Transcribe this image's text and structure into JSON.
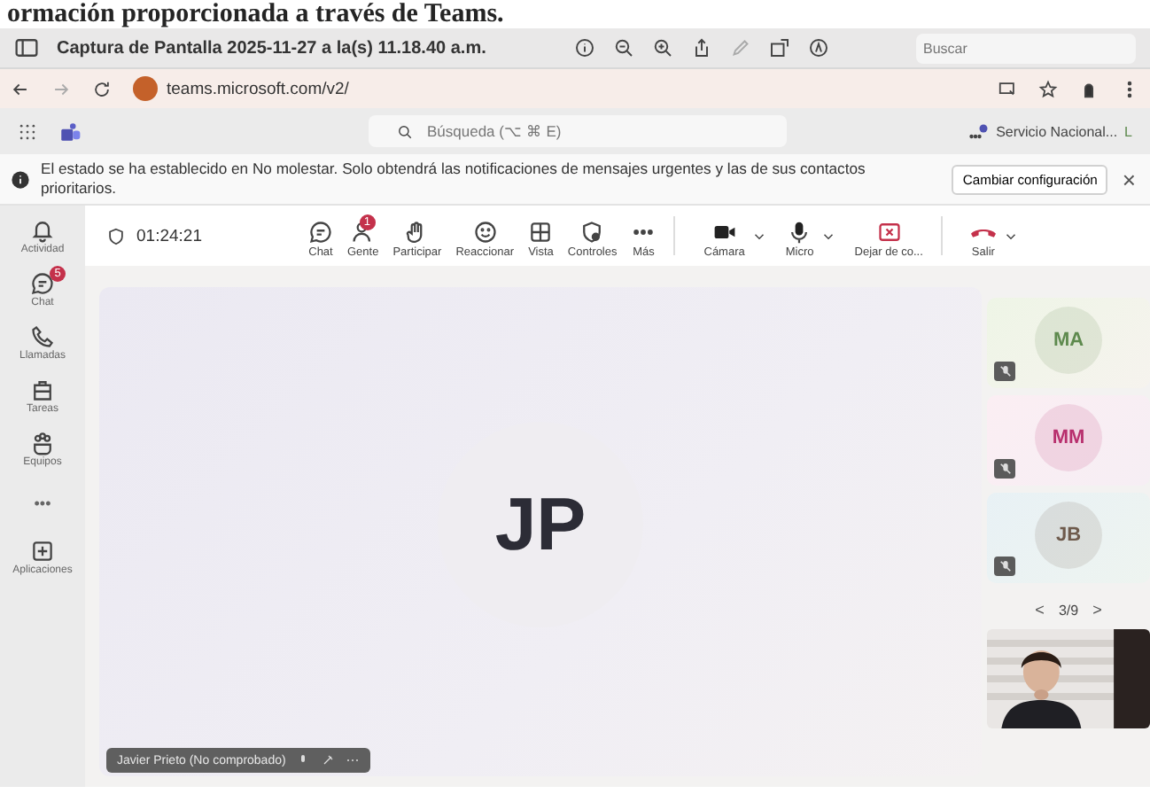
{
  "document_text": "ormación proporcionada a través de Teams.",
  "viewer": {
    "title": "Captura de Pantalla 2025-11-27 a la(s) 11.18.40 a.m.",
    "search_placeholder": "Buscar"
  },
  "browser": {
    "url": "teams.microsoft.com/v2/"
  },
  "teams_header": {
    "search_placeholder": "Búsqueda (⌥ ⌘ E)",
    "org": "Servicio Nacional...",
    "account_initial": "L"
  },
  "banner": {
    "text": "El estado se ha establecido en No molestar. Solo obtendrá las notificaciones de mensajes urgentes y las de sus contactos prioritarios.",
    "button": "Cambiar configuración",
    "close": "×"
  },
  "rail": [
    {
      "label": "Actividad",
      "kind": "bell"
    },
    {
      "label": "Chat",
      "kind": "chat",
      "badge": "5"
    },
    {
      "label": "Llamadas",
      "kind": "phone"
    },
    {
      "label": "Tareas",
      "kind": "tasks"
    },
    {
      "label": "Equipos",
      "kind": "teams"
    },
    {
      "label": "•••",
      "kind": "more"
    },
    {
      "label": "Aplicaciones",
      "kind": "apps"
    }
  ],
  "meeting": {
    "timer": "01:24:21",
    "controls": [
      {
        "label": "Chat",
        "kind": "chat"
      },
      {
        "label": "Gente",
        "kind": "people",
        "badge": "1"
      },
      {
        "label": "Participar",
        "kind": "hand"
      },
      {
        "label": "Reaccionar",
        "kind": "smile"
      },
      {
        "label": "Vista",
        "kind": "grid"
      },
      {
        "label": "Controles",
        "kind": "shield"
      },
      {
        "label": "Más",
        "kind": "more"
      }
    ],
    "devices": [
      {
        "label": "Cámara",
        "kind": "camera",
        "dropdown": true
      },
      {
        "label": "Micro",
        "kind": "mic",
        "dropdown": true
      },
      {
        "label": "Dejar de co...",
        "kind": "share",
        "dropdown": false
      },
      {
        "label": "Salir",
        "kind": "hangup",
        "dropdown": true
      }
    ]
  },
  "stage": {
    "initials": "JP",
    "name_tag": "Javier Prieto (No comprobado)"
  },
  "participants": [
    {
      "initials": "MA",
      "color": "#5e8a4e",
      "muted": true
    },
    {
      "initials": "MM",
      "color": "#b8306e",
      "muted": true
    },
    {
      "initials": "JB",
      "color": "#6e5a4c",
      "muted": true
    }
  ],
  "pager": {
    "prev": "<",
    "text": "3/9",
    "next": ">"
  }
}
